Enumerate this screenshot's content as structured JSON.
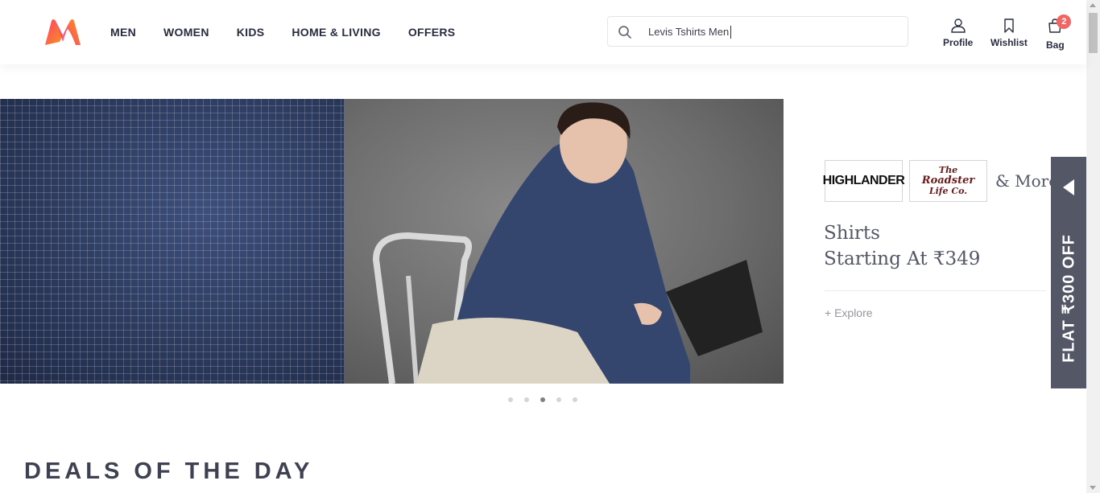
{
  "header": {
    "nav": [
      "MEN",
      "WOMEN",
      "KIDS",
      "HOME & LIVING",
      "OFFERS"
    ],
    "search": {
      "value": "Levis Tshirts Men",
      "icon": "search-icon"
    },
    "actions": {
      "profile": "Profile",
      "wishlist": "Wishlist",
      "bag": "Bag",
      "bag_count": "2"
    },
    "colors": {
      "brand_pink": "#ff3f6c",
      "brand_orange": "#f7941d",
      "badge": "#f16565"
    }
  },
  "banner": {
    "brands": {
      "highlander": "HIGHLANDER",
      "roadster_line1": "The",
      "roadster_line2": "Roadster",
      "roadster_line3": "Life Co."
    },
    "more": "& More",
    "title_line1": "Shirts",
    "title_line2": "Starting At ₹349",
    "explore": "+ Explore",
    "dots_total": 5,
    "active_dot": 3
  },
  "side_offer": {
    "text": "FLAT ₹300 OFF"
  },
  "sections": {
    "deals_title": "DEALS OF THE DAY"
  }
}
